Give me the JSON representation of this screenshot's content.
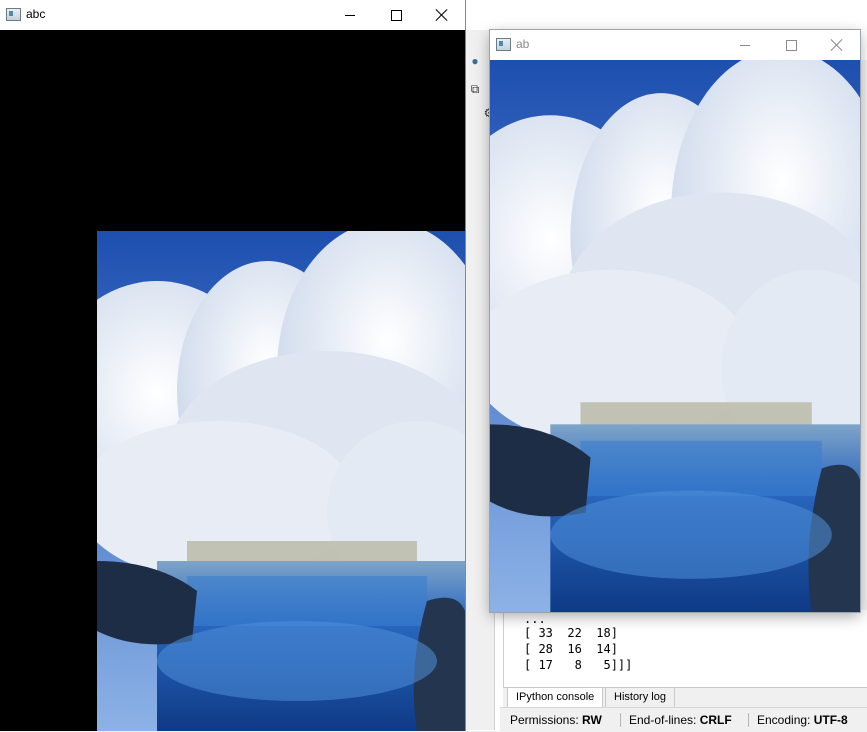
{
  "window_abc": {
    "title": "abc"
  },
  "window_ab": {
    "title": "ab"
  },
  "console": {
    "lines": [
      "...",
      "[ 33  22  18]",
      "[ 28  16  14]",
      "[ 17   8   5]]]"
    ]
  },
  "ide_tabs": [
    "IPython console",
    "History log"
  ],
  "statusbar": {
    "permissions_label": "Permissions:",
    "permissions_value": "RW",
    "eol_label": "End-of-lines:",
    "eol_value": "CRLF",
    "encoding_label": "Encoding:",
    "encoding_value": "UTF-8"
  },
  "icons": [
    "window-app-icon",
    "minimize-icon",
    "maximize-icon",
    "close-icon",
    "python-icon",
    "undock-icon",
    "settings-gear-icon"
  ],
  "colors": {
    "sky": "#2a63c4",
    "water": "#1e5ab0",
    "snow": "#eef3fb",
    "canvas_black": "#000000"
  }
}
